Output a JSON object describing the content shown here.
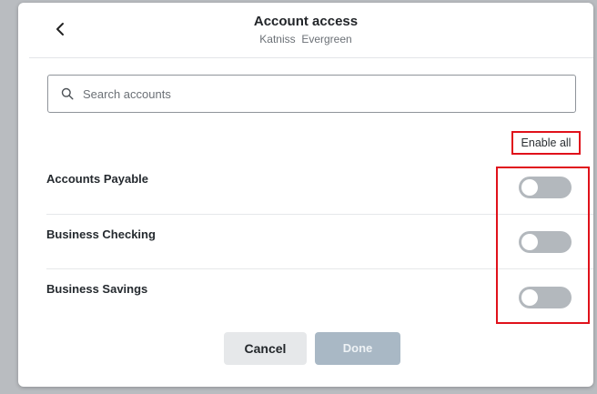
{
  "header": {
    "title": "Account access",
    "subtitle": "Katniss  Evergreen",
    "back_icon": "chevron-left-icon"
  },
  "search": {
    "placeholder": "Search accounts",
    "value": "",
    "icon": "search-icon"
  },
  "enable_all_label": "Enable all",
  "accounts": [
    {
      "label": "Accounts Payable",
      "enabled": false
    },
    {
      "label": "Business Checking",
      "enabled": false
    },
    {
      "label": "Business Savings",
      "enabled": false
    }
  ],
  "footer": {
    "cancel_label": "Cancel",
    "done_label": "Done",
    "done_disabled": true
  },
  "colors": {
    "highlight": "#e0111b",
    "toggle_off": "#b3b8bd",
    "done_disabled": "#a9b8c5"
  }
}
